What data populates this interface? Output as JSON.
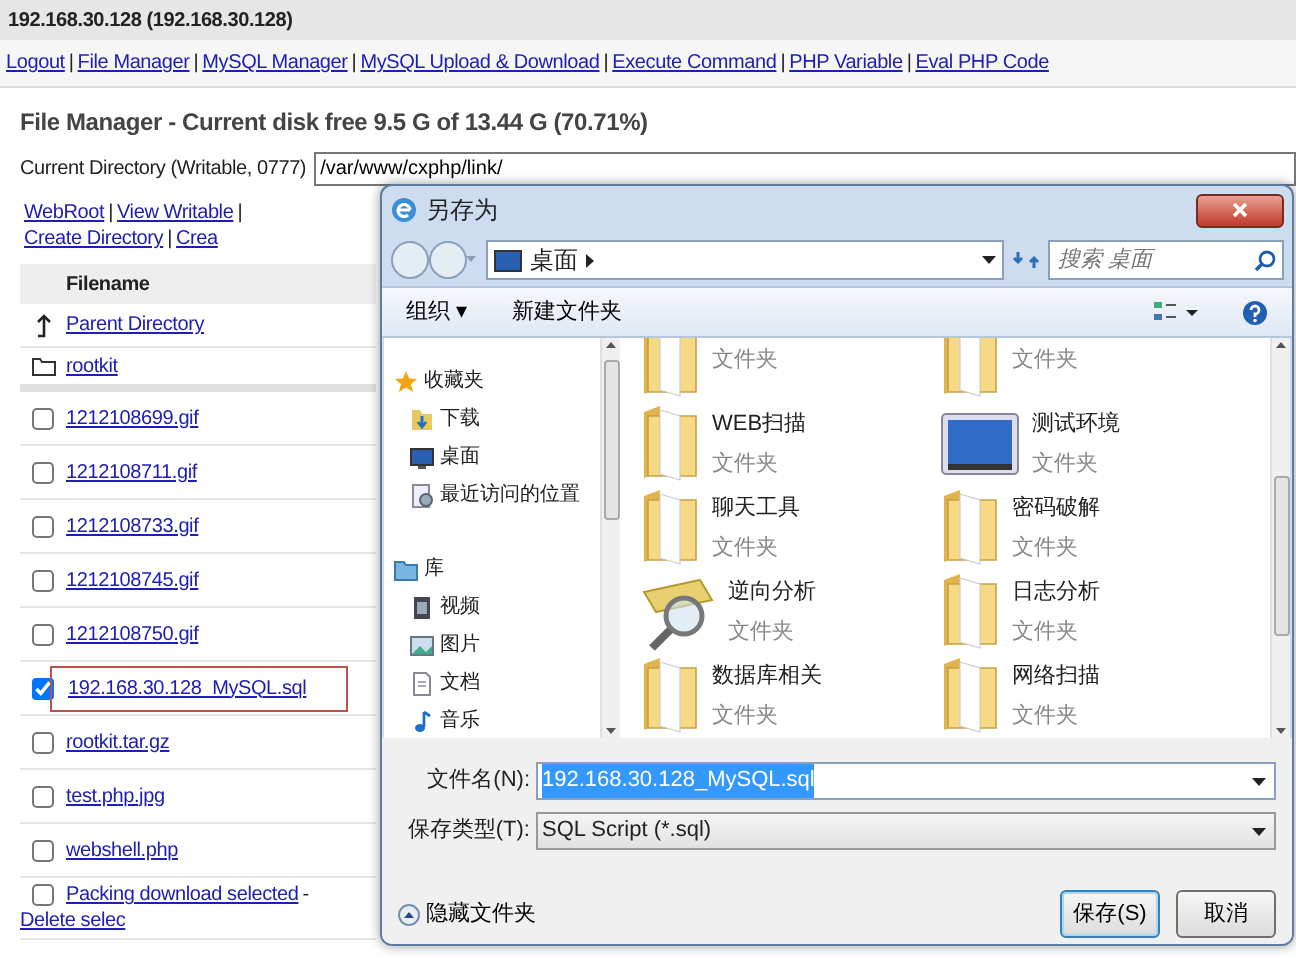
{
  "page": {
    "title": "192.168.30.128 (192.168.30.128)",
    "nav": {
      "separator": "|",
      "links": [
        "Logout",
        "File Manager",
        "MySQL Manager",
        "MySQL Upload & Download",
        "Execute Command",
        "PHP Variable",
        "Eval PHP Code"
      ]
    },
    "heading": "File Manager - Current disk free 9.5 G of 13.44 G (70.71%)",
    "current_directory": {
      "label": "Current Directory (Writable, 0777)",
      "value": "/var/www/cxphp/link/"
    },
    "actions": {
      "separator": "|",
      "links": [
        "WebRoot",
        "View Writable",
        "Create Directory",
        "Crea"
      ]
    },
    "table": {
      "column": "Filename",
      "rows": [
        {
          "kind": "parent",
          "name": "Parent Directory"
        },
        {
          "kind": "folder",
          "name": "rootkit"
        },
        {
          "kind": "file",
          "name": "1212108699.gif",
          "checked": false,
          "highlighted": false
        },
        {
          "kind": "file",
          "name": "1212108711.gif",
          "checked": false,
          "highlighted": false
        },
        {
          "kind": "file",
          "name": "1212108733.gif",
          "checked": false,
          "highlighted": false
        },
        {
          "kind": "file",
          "name": "1212108745.gif",
          "checked": false,
          "highlighted": false
        },
        {
          "kind": "file",
          "name": "1212108750.gif",
          "checked": false,
          "highlighted": false
        },
        {
          "kind": "file",
          "name": "192.168.30.128_MySQL.sql",
          "checked": true,
          "highlighted": true
        },
        {
          "kind": "file",
          "name": "rootkit.tar.gz",
          "checked": false,
          "highlighted": false
        },
        {
          "kind": "file",
          "name": "test.php.jpg",
          "checked": false,
          "highlighted": false
        },
        {
          "kind": "file",
          "name": "webshell.php",
          "checked": false,
          "highlighted": false
        }
      ]
    },
    "footer": {
      "checked": false,
      "separator": "-",
      "links": [
        "Packing download selected",
        "Delete selec"
      ]
    }
  },
  "dialog": {
    "title": "另存为",
    "address": {
      "location": "桌面",
      "search_placeholder": "搜索 桌面"
    },
    "toolbar": {
      "organize": "组织 ▾",
      "new_folder": "新建文件夹"
    },
    "nav_tree": [
      {
        "kind": "star",
        "label": "收藏夹",
        "children": [
          {
            "kind": "download",
            "label": "下载"
          },
          {
            "kind": "desktop",
            "label": "桌面"
          },
          {
            "kind": "recent",
            "label": "最近访问的位置"
          }
        ]
      },
      {
        "kind": "library",
        "label": "库",
        "children": [
          {
            "kind": "video",
            "label": "视频"
          },
          {
            "kind": "picture",
            "label": "图片"
          },
          {
            "kind": "document",
            "label": "文档"
          },
          {
            "kind": "music",
            "label": "音乐"
          }
        ]
      }
    ],
    "items": [
      {
        "kind": "folder",
        "type_label": "文件夹"
      },
      {
        "kind": "folder",
        "type_label": "文件夹"
      },
      {
        "kind": "folder",
        "name": "WEB扫描",
        "type_label": "文件夹"
      },
      {
        "kind": "screen",
        "name": "测试环境",
        "type_label": "文件夹"
      },
      {
        "kind": "folder",
        "name": "聊天工具",
        "type_label": "文件夹"
      },
      {
        "kind": "folder",
        "name": "密码破解",
        "type_label": "文件夹"
      },
      {
        "kind": "magnifier",
        "name": "逆向分析",
        "type_label": "文件夹"
      },
      {
        "kind": "folder",
        "name": "日志分析",
        "type_label": "文件夹"
      },
      {
        "kind": "folder",
        "name": "数据库相关",
        "type_label": "文件夹"
      },
      {
        "kind": "folder",
        "name": "网络扫描",
        "type_label": "文件夹"
      }
    ],
    "filename": {
      "label": "文件名(N):",
      "value": "192.168.30.128_MySQL.sql",
      "selected": true
    },
    "file_type": {
      "label": "保存类型(T):",
      "value": "SQL Script (*.sql)"
    },
    "hide_folders": "隐藏文件夹",
    "buttons": [
      {
        "kind": "primary",
        "label": "保存(S)"
      },
      {
        "kind": "secondary",
        "label": "取消"
      }
    ]
  }
}
